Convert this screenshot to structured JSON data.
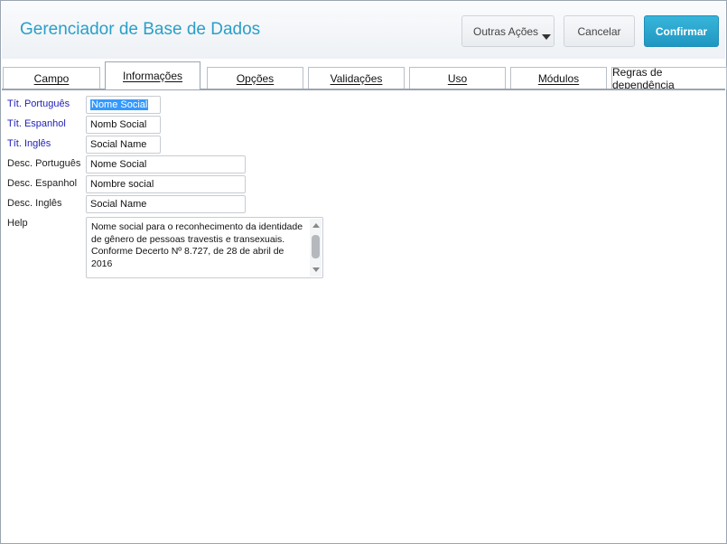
{
  "header": {
    "title": "Gerenciador de Base de Dados",
    "buttons": {
      "outras_acoes": "Outras Ações",
      "cancelar": "Cancelar",
      "confirmar": "Confirmar"
    },
    "accent_color": "#2a9fc7"
  },
  "tabs": [
    {
      "label": "Campo",
      "active": false
    },
    {
      "label": "Informações",
      "active": true
    },
    {
      "label": "Opções",
      "active": false
    },
    {
      "label": "Validações",
      "active": false
    },
    {
      "label": "Uso",
      "active": false
    },
    {
      "label": "Módulos",
      "active": false
    },
    {
      "label": "Regras de dependência",
      "active": false
    }
  ],
  "form": {
    "tit_portugues": {
      "label": "Tít. Português",
      "value": "Nome Social"
    },
    "tit_espanhol": {
      "label": "Tít. Espanhol",
      "value": "Nomb Social"
    },
    "tit_ingles": {
      "label": "Tít. Inglês",
      "value": "Social Name"
    },
    "desc_portugues": {
      "label": "Desc. Português",
      "value": "Nome Social"
    },
    "desc_espanhol": {
      "label": "Desc. Espanhol",
      "value": "Nombre social"
    },
    "desc_ingles": {
      "label": "Desc. Inglês",
      "value": "Social Name"
    },
    "help": {
      "label": "Help",
      "value": "Nome social para o reconhecimento da identidade de gênero de pessoas travestis e transexuais. Conforme Decerto Nº 8.727, de 28 de abril de 2016"
    }
  }
}
